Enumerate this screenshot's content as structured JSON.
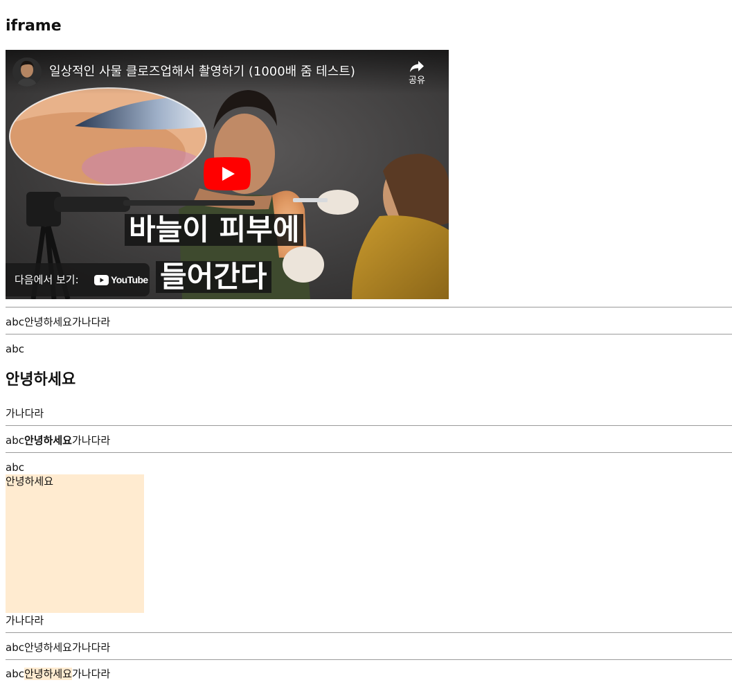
{
  "page": {
    "title": "iframe"
  },
  "video": {
    "title": "일상적인 사물 클로즈업해서 촬영하기 (1000배 줌 테스트)",
    "share_label": "공유",
    "caption_line1": "바늘이 피부에",
    "caption_line2": "들어간다",
    "watch_on_label": "다음에서 보기:",
    "youtube_word": "YouTube"
  },
  "content": {
    "row1": {
      "a": "abc",
      "b": "안녕하세요",
      "c": "가나다라"
    },
    "row2": {
      "a": "abc",
      "heading": "안녕하세요",
      "c": "가나다라"
    },
    "row3": {
      "a": "abc",
      "b": "안녕하세요",
      "c": "가나다라"
    },
    "row4": {
      "a": "abc",
      "box": "안녕하세요",
      "c": "가나다라"
    },
    "row5": {
      "a": "abc",
      "b": "안녕하세요",
      "c": "가나다라"
    },
    "row6": {
      "a": "abc",
      "b": "안녕하세요",
      "c": "가나다라"
    }
  },
  "colors": {
    "highlight": "#ffebd0",
    "youtube_red": "#ff0000",
    "rule": "#9a9a9a"
  }
}
